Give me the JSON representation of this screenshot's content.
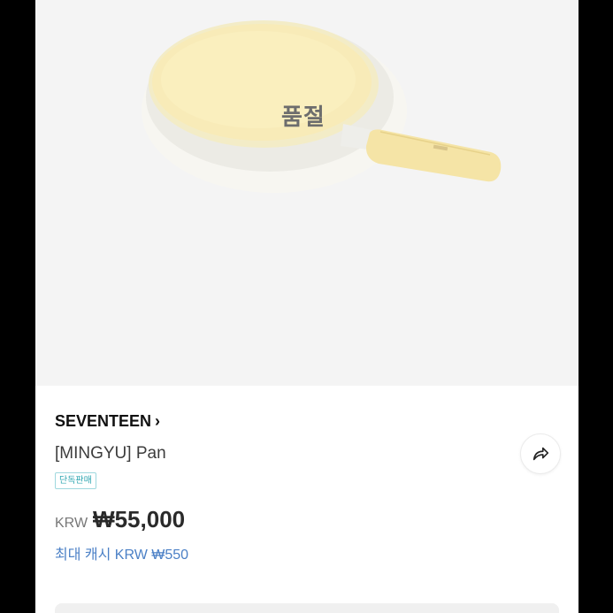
{
  "product": {
    "status_overlay": "품절",
    "brand": "SEVENTEEN",
    "brand_chevron": "›",
    "name": "[MINGYU] Pan",
    "badge": "단독판매",
    "currency": "KRW",
    "price": "₩55,000",
    "cash_reward": "최대 캐시 KRW ₩550"
  },
  "icons": {
    "share": "share-arrow-icon",
    "brand_link": "chevron-right-icon"
  }
}
